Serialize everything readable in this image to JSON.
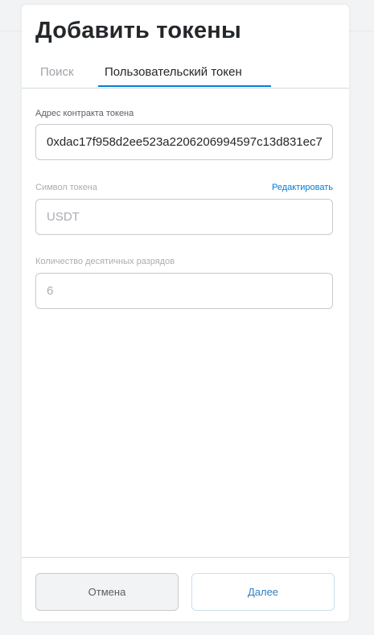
{
  "page": {
    "title": "Добавить токены"
  },
  "tabs": {
    "search_label": "Поиск",
    "custom_label": "Пользовательский токен",
    "active": "custom"
  },
  "form": {
    "address_label": "Адрес контракта токена",
    "address_value": "0xdac17f958d2ee523a2206206994597c13d831ec7",
    "symbol_label": "Символ токена",
    "symbol_edit_label": "Редактировать",
    "symbol_value": "USDT",
    "decimals_label": "Количество десятичных разрядов",
    "decimals_value": "6"
  },
  "footer": {
    "cancel_label": "Отмена",
    "next_label": "Далее"
  },
  "colors": {
    "accent": "#037dd6",
    "text_primary": "#24272a",
    "text_muted": "#a9adb1",
    "border": "#c8cacd",
    "background": "#f2f3f4"
  }
}
